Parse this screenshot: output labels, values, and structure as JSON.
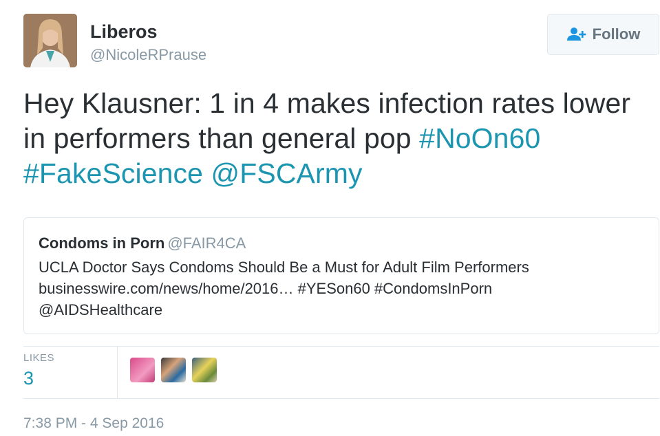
{
  "author": {
    "display_name": "Liberos",
    "screen_name": "@NicoleRPrause"
  },
  "follow_button": {
    "label": "Follow",
    "icon": "add-user-icon"
  },
  "tweet": {
    "text_plain": "Hey Klausner: 1 in 4 makes infection rates lower in performers than general pop ",
    "hashtag_1": "#NoOn60",
    "hashtag_2": "#FakeScience",
    "mention": "@FSCArmy"
  },
  "quote": {
    "name": "Condoms in Porn",
    "handle": "@FAIR4CA",
    "line_1": "UCLA Doctor Says Condoms Should Be a Must for Adult Film Performers",
    "line_2": "businesswire.com/news/home/2016… #YESon60 #CondomsInPorn",
    "line_3": "@AIDSHealthcare"
  },
  "stats": {
    "likes_label": "LIKES",
    "likes_count": "3"
  },
  "timestamp": "7:38 PM - 4 Sep 2016",
  "colors": {
    "link": "#1b95b0",
    "text": "#292f33",
    "muted": "#8899a6",
    "border": "#e1e8ed"
  }
}
